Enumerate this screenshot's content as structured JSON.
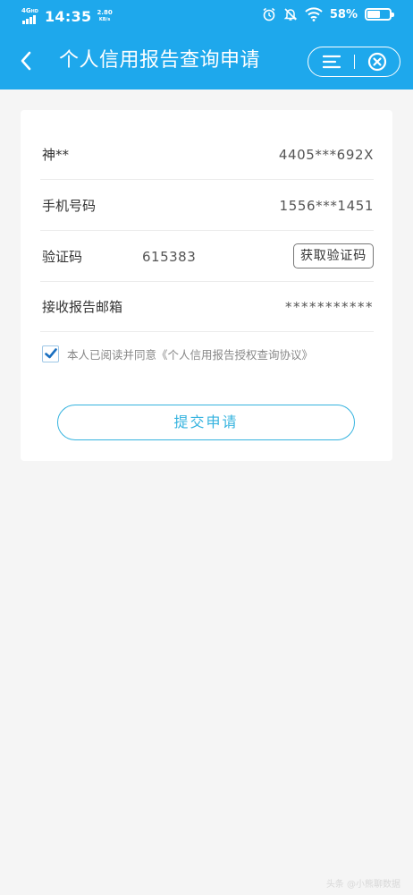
{
  "status_bar": {
    "network": "4G",
    "network_hd": "HD",
    "time": "14:35",
    "speed_value": "2.80",
    "speed_unit": "KB/s",
    "battery_percent": "58%",
    "battery_level": 0.58,
    "icons": [
      "alarm-icon",
      "mute-icon",
      "wifi-icon",
      "battery-icon"
    ]
  },
  "navbar": {
    "title": "个人信用报告查询申请",
    "back_icon": "chevron-left-icon",
    "menu_icon": "hamburger-menu-icon",
    "close_icon": "close-circle-icon"
  },
  "form": {
    "name": {
      "label": "神**",
      "value": "4405***692X"
    },
    "phone": {
      "label": "手机号码",
      "value": "1556***1451"
    },
    "code": {
      "label": "验证码",
      "value": "615383",
      "button_label": "获取验证码"
    },
    "email": {
      "label": "接收报告邮箱",
      "value": "***********"
    },
    "agreement": {
      "checked": true,
      "text": "本人已阅读并同意《个人信用报告授权查询协议》"
    },
    "submit_label": "提交申请"
  },
  "watermark": "头条 @小熊聊数据",
  "colors": {
    "brand": "#1ea8ec",
    "accent": "#35b3df",
    "background": "#f5f5f5"
  }
}
